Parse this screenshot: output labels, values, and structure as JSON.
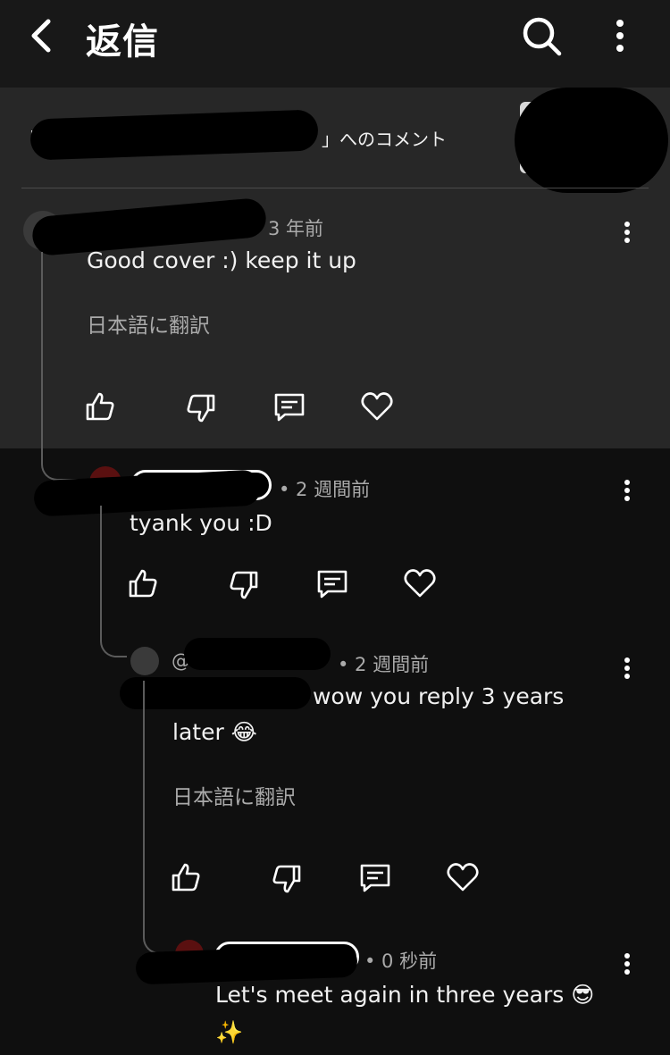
{
  "header": {
    "title": "返信",
    "back_icon": "chevron-left-icon",
    "search_icon": "search-icon",
    "more_icon": "more-vertical-icon"
  },
  "video": {
    "context_prefix": "「",
    "context_suffix": "」へのコメント"
  },
  "comments": [
    {
      "time": "3 年前",
      "text": "Good cover :) keep it up",
      "translate": "日本語に翻訳"
    },
    {
      "time": "• 2 週間前",
      "text": "tyank you :D"
    },
    {
      "handle_partial": "@",
      "time": "• 2 週間前",
      "text_line1": "wow you reply 3 years",
      "text_line2": "later 😂",
      "translate": "日本語に翻訳"
    },
    {
      "time": "• 0 秒前",
      "text_line1": "Let's meet again in three years 😎",
      "text_line2": "✨"
    }
  ],
  "actions": {
    "like_icon": "thumbs-up-icon",
    "dislike_icon": "thumbs-down-icon",
    "reply_icon": "reply-icon",
    "heart_icon": "heart-icon"
  },
  "colors": {
    "background": "#0f0f0f",
    "topbar": "#181818",
    "panel": "#272727",
    "text": "#f1f1f1",
    "secondary": "#aaaaaa"
  }
}
